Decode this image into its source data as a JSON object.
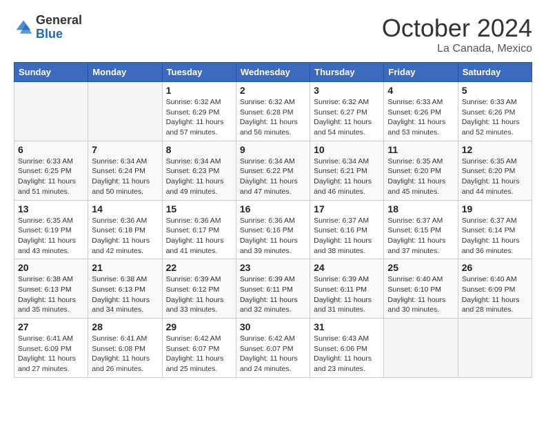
{
  "header": {
    "logo_general": "General",
    "logo_blue": "Blue",
    "month_title": "October 2024",
    "location": "La Canada, Mexico"
  },
  "weekdays": [
    "Sunday",
    "Monday",
    "Tuesday",
    "Wednesday",
    "Thursday",
    "Friday",
    "Saturday"
  ],
  "weeks": [
    [
      {
        "day": "",
        "info": ""
      },
      {
        "day": "",
        "info": ""
      },
      {
        "day": "1",
        "info": "Sunrise: 6:32 AM\nSunset: 6:29 PM\nDaylight: 11 hours and 57 minutes."
      },
      {
        "day": "2",
        "info": "Sunrise: 6:32 AM\nSunset: 6:28 PM\nDaylight: 11 hours and 56 minutes."
      },
      {
        "day": "3",
        "info": "Sunrise: 6:32 AM\nSunset: 6:27 PM\nDaylight: 11 hours and 54 minutes."
      },
      {
        "day": "4",
        "info": "Sunrise: 6:33 AM\nSunset: 6:26 PM\nDaylight: 11 hours and 53 minutes."
      },
      {
        "day": "5",
        "info": "Sunrise: 6:33 AM\nSunset: 6:26 PM\nDaylight: 11 hours and 52 minutes."
      }
    ],
    [
      {
        "day": "6",
        "info": "Sunrise: 6:33 AM\nSunset: 6:25 PM\nDaylight: 11 hours and 51 minutes."
      },
      {
        "day": "7",
        "info": "Sunrise: 6:34 AM\nSunset: 6:24 PM\nDaylight: 11 hours and 50 minutes."
      },
      {
        "day": "8",
        "info": "Sunrise: 6:34 AM\nSunset: 6:23 PM\nDaylight: 11 hours and 49 minutes."
      },
      {
        "day": "9",
        "info": "Sunrise: 6:34 AM\nSunset: 6:22 PM\nDaylight: 11 hours and 47 minutes."
      },
      {
        "day": "10",
        "info": "Sunrise: 6:34 AM\nSunset: 6:21 PM\nDaylight: 11 hours and 46 minutes."
      },
      {
        "day": "11",
        "info": "Sunrise: 6:35 AM\nSunset: 6:20 PM\nDaylight: 11 hours and 45 minutes."
      },
      {
        "day": "12",
        "info": "Sunrise: 6:35 AM\nSunset: 6:20 PM\nDaylight: 11 hours and 44 minutes."
      }
    ],
    [
      {
        "day": "13",
        "info": "Sunrise: 6:35 AM\nSunset: 6:19 PM\nDaylight: 11 hours and 43 minutes."
      },
      {
        "day": "14",
        "info": "Sunrise: 6:36 AM\nSunset: 6:18 PM\nDaylight: 11 hours and 42 minutes."
      },
      {
        "day": "15",
        "info": "Sunrise: 6:36 AM\nSunset: 6:17 PM\nDaylight: 11 hours and 41 minutes."
      },
      {
        "day": "16",
        "info": "Sunrise: 6:36 AM\nSunset: 6:16 PM\nDaylight: 11 hours and 39 minutes."
      },
      {
        "day": "17",
        "info": "Sunrise: 6:37 AM\nSunset: 6:16 PM\nDaylight: 11 hours and 38 minutes."
      },
      {
        "day": "18",
        "info": "Sunrise: 6:37 AM\nSunset: 6:15 PM\nDaylight: 11 hours and 37 minutes."
      },
      {
        "day": "19",
        "info": "Sunrise: 6:37 AM\nSunset: 6:14 PM\nDaylight: 11 hours and 36 minutes."
      }
    ],
    [
      {
        "day": "20",
        "info": "Sunrise: 6:38 AM\nSunset: 6:13 PM\nDaylight: 11 hours and 35 minutes."
      },
      {
        "day": "21",
        "info": "Sunrise: 6:38 AM\nSunset: 6:13 PM\nDaylight: 11 hours and 34 minutes."
      },
      {
        "day": "22",
        "info": "Sunrise: 6:39 AM\nSunset: 6:12 PM\nDaylight: 11 hours and 33 minutes."
      },
      {
        "day": "23",
        "info": "Sunrise: 6:39 AM\nSunset: 6:11 PM\nDaylight: 11 hours and 32 minutes."
      },
      {
        "day": "24",
        "info": "Sunrise: 6:39 AM\nSunset: 6:11 PM\nDaylight: 11 hours and 31 minutes."
      },
      {
        "day": "25",
        "info": "Sunrise: 6:40 AM\nSunset: 6:10 PM\nDaylight: 11 hours and 30 minutes."
      },
      {
        "day": "26",
        "info": "Sunrise: 6:40 AM\nSunset: 6:09 PM\nDaylight: 11 hours and 28 minutes."
      }
    ],
    [
      {
        "day": "27",
        "info": "Sunrise: 6:41 AM\nSunset: 6:09 PM\nDaylight: 11 hours and 27 minutes."
      },
      {
        "day": "28",
        "info": "Sunrise: 6:41 AM\nSunset: 6:08 PM\nDaylight: 11 hours and 26 minutes."
      },
      {
        "day": "29",
        "info": "Sunrise: 6:42 AM\nSunset: 6:07 PM\nDaylight: 11 hours and 25 minutes."
      },
      {
        "day": "30",
        "info": "Sunrise: 6:42 AM\nSunset: 6:07 PM\nDaylight: 11 hours and 24 minutes."
      },
      {
        "day": "31",
        "info": "Sunrise: 6:43 AM\nSunset: 6:06 PM\nDaylight: 11 hours and 23 minutes."
      },
      {
        "day": "",
        "info": ""
      },
      {
        "day": "",
        "info": ""
      }
    ]
  ]
}
